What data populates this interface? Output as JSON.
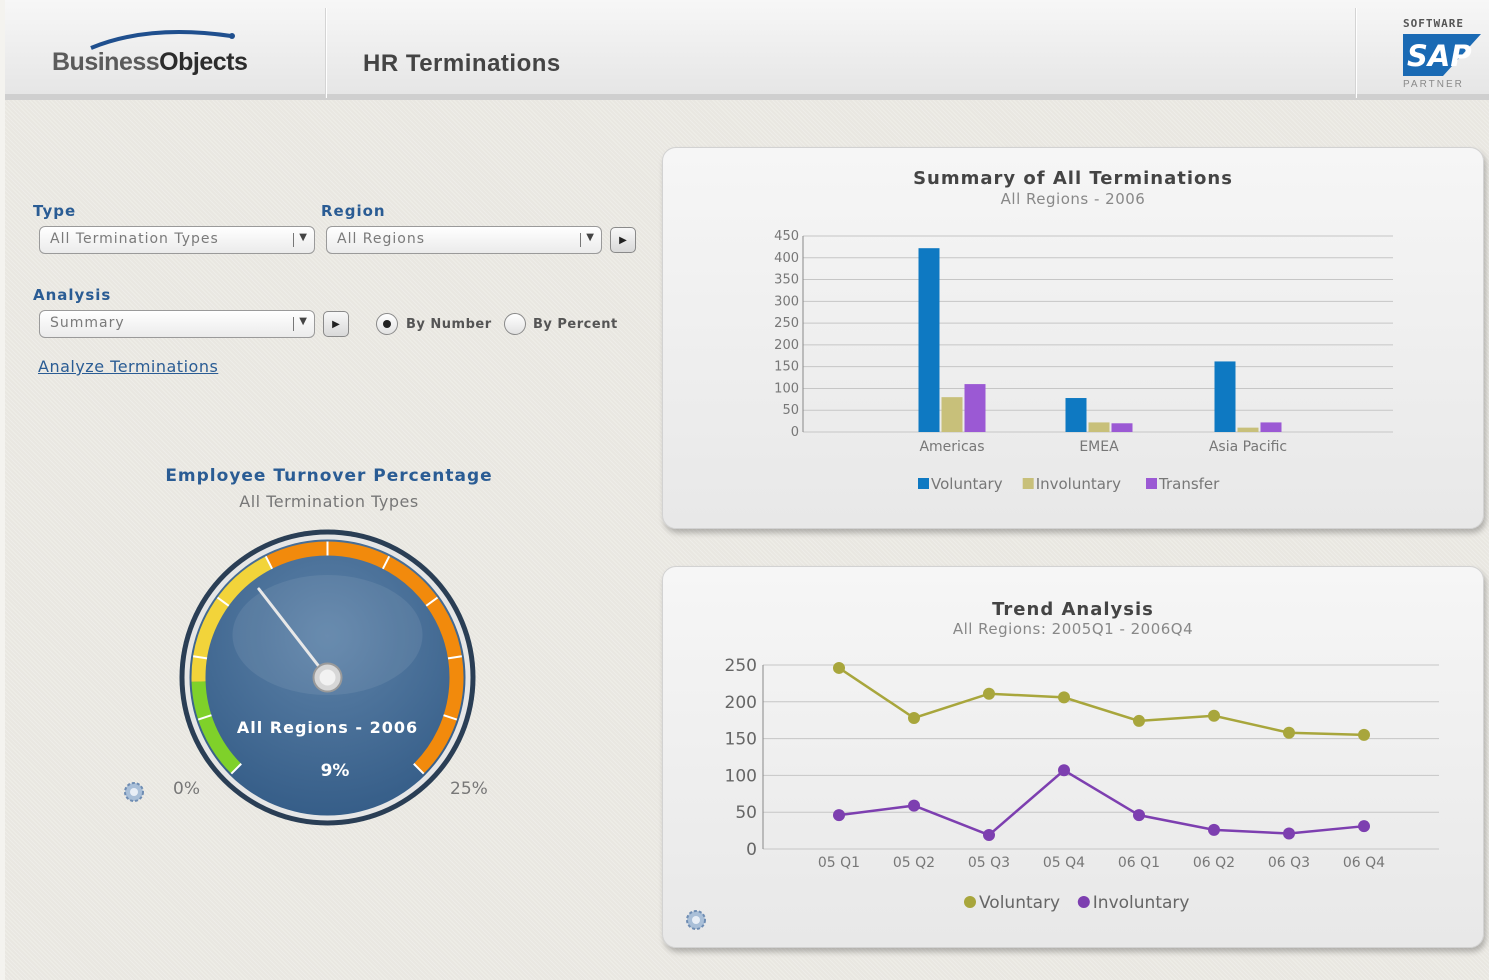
{
  "header": {
    "brand_part1": "Business",
    "brand_part2": "Objects",
    "title": "HR Terminations",
    "partner_top": "SOFTWARE",
    "partner_logo": "SAP",
    "partner_bottom": "PARTNER"
  },
  "filters": {
    "type_label": "Type",
    "type_value": "All Termination Types",
    "region_label": "Region",
    "region_value": "All Regions",
    "analysis_label": "Analysis",
    "analysis_value": "Summary",
    "radio_number": "By Number",
    "radio_percent": "By Percent",
    "selected_mode": "By Number",
    "analyze_link": "Analyze Terminations"
  },
  "gauge": {
    "title": "Employee Turnover Percentage",
    "subtitle": "All Termination Types",
    "caption": "All Regions - 2006",
    "value_text": "9%",
    "value": 9,
    "min": 0,
    "max": 25,
    "min_label": "0%",
    "max_label": "25%",
    "colors": {
      "green": "#7fd12a",
      "yellow": "#f2d43a",
      "orange": "#f28a0c",
      "face": "#3f6690"
    }
  },
  "summary_chart": {
    "title": "Summary of  All Terminations",
    "subtitle": "All Regions - 2006",
    "chart_data": {
      "type": "bar",
      "categories": [
        "Americas",
        "EMEA",
        "Asia Pacific"
      ],
      "series": [
        {
          "name": "Voluntary",
          "values": [
            422,
            78,
            162
          ],
          "color": "#0e79c2"
        },
        {
          "name": "Involuntary",
          "values": [
            80,
            22,
            10
          ],
          "color": "#c8c07a"
        },
        {
          "name": "Transfer",
          "values": [
            110,
            20,
            22
          ],
          "color": "#9b59d4"
        }
      ],
      "ylim": [
        0,
        450
      ],
      "yticks": [
        "0",
        "50",
        "100",
        "150",
        "200",
        "250",
        "300",
        "350",
        "400",
        "450"
      ],
      "grid": true,
      "legend": "bottom"
    }
  },
  "trend_chart": {
    "title": "Trend Analysis",
    "subtitle": "All Regions:  2005Q1 - 2006Q4",
    "chart_data": {
      "type": "line",
      "categories": [
        "05 Q1",
        "05 Q2",
        "05 Q3",
        "05 Q4",
        "06 Q1",
        "06 Q2",
        "06 Q3",
        "06 Q4"
      ],
      "series": [
        {
          "name": "Voluntary",
          "values": [
            246,
            178,
            211,
            206,
            174,
            181,
            158,
            155
          ],
          "color": "#a8a63c"
        },
        {
          "name": "Involuntary",
          "values": [
            46,
            59,
            19,
            107,
            46,
            26,
            21,
            31
          ],
          "color": "#7d3fb0"
        }
      ],
      "ylim": [
        0,
        250
      ],
      "yticks": [
        "0",
        "50",
        "100",
        "150",
        "200",
        "250"
      ],
      "grid": true,
      "legend": "bottom"
    }
  }
}
